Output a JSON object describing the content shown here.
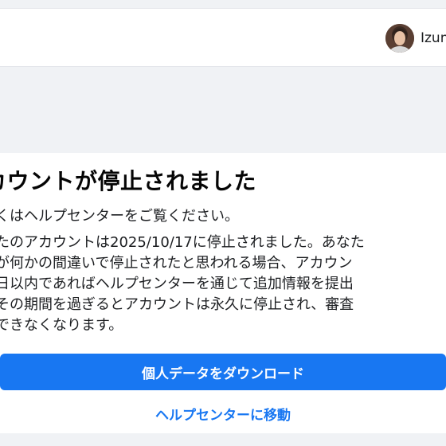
{
  "header": {
    "user_name": "Izum"
  },
  "notice": {
    "title": "カウントが停止されました",
    "subtitle": "くはヘルプセンターをご覧ください。",
    "body_lines": [
      "たのアカウントは2025/10/17に停止されました。あなた",
      "が何かの間違いで停止されたと思われる場合、アカウン",
      "日以内であればヘルプセンターを通じて追加情報を提出",
      "その期間を過ぎるとアカウントは永久に停止され、審査",
      "できなくなります。"
    ]
  },
  "actions": {
    "download_label": "個人データをダウンロード",
    "help_center_label": "ヘルプセンターに移動"
  },
  "colors": {
    "accent": "#1877f2",
    "background": "#f0f2f5",
    "text": "#1c1e21"
  }
}
